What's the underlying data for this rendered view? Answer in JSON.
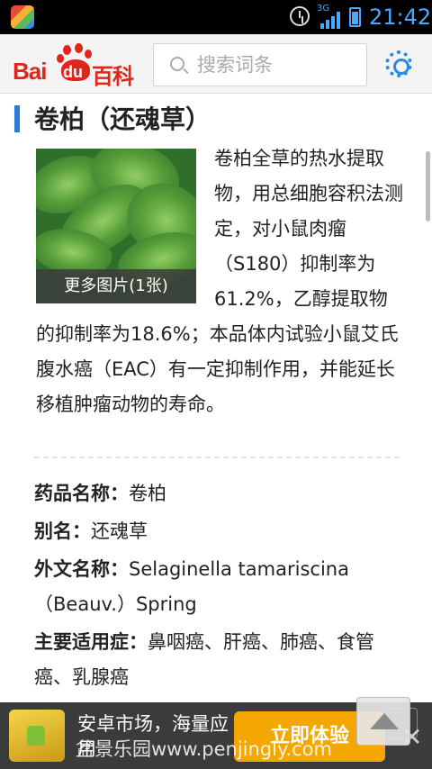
{
  "status_bar": {
    "network": "3G",
    "time": "21:42",
    "icons": [
      "app-icon",
      "alarm-icon",
      "signal-icon",
      "battery-icon"
    ]
  },
  "header": {
    "logo_bai": "Bai",
    "logo_du": "du",
    "logo_baike": "百科",
    "search_placeholder": "搜索词条",
    "icons": [
      "search-icon",
      "gear-icon"
    ],
    "accent_color": "#2a8be5",
    "brand_color": "#e1251b"
  },
  "article": {
    "title": "卷柏（还魂草）",
    "image_caption": "更多图片(1张)",
    "intro": "卷柏全草的热水提取物，用总细胞容积法测定，对小鼠肉瘤（S180）抑制率为61.2%，乙醇提取物的抑制率为18.6%；本品体内试验小鼠艾氏腹水癌（EAC）有一定抑制作用，并能延长移植肿瘤动物的寿命。",
    "info": [
      {
        "label": "药品名称：",
        "value": "卷柏"
      },
      {
        "label": "别名：",
        "value": "还魂草"
      },
      {
        "label": "外文名称：",
        "value": "Selaginella tamariscina（Beauv.）Spring"
      },
      {
        "label": "主要适用症：",
        "value": "鼻咽癌、肝癌、肺癌、食管癌、乳腺癌"
      }
    ]
  },
  "ad": {
    "text": "安卓市场，海量应用",
    "button": "立即体验",
    "close": "✕",
    "watermark": "盆景乐园www.penjingly.com"
  }
}
